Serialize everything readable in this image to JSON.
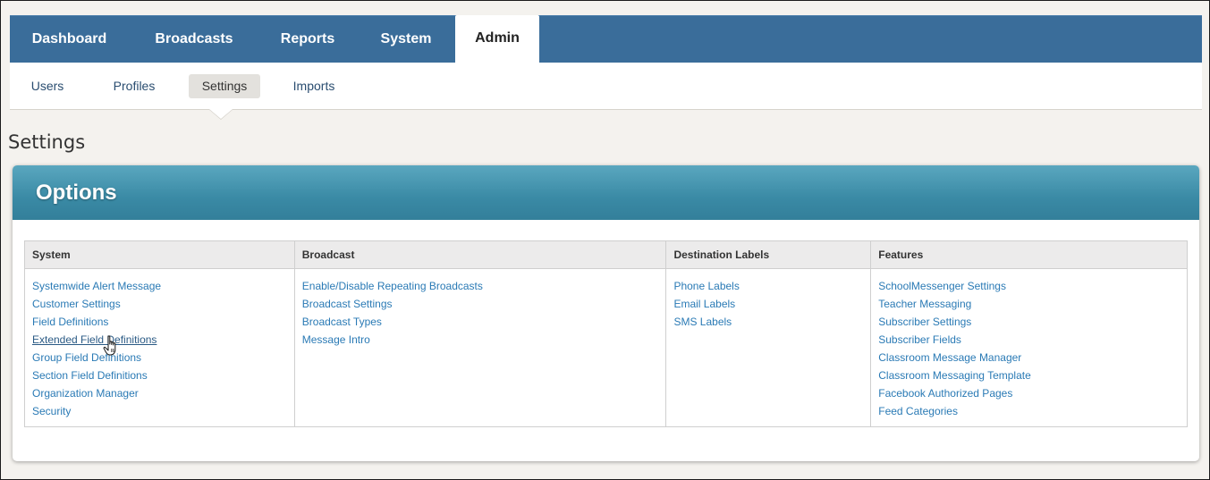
{
  "top_tabs": [
    {
      "label": "Dashboard",
      "active": false
    },
    {
      "label": "Broadcasts",
      "active": false
    },
    {
      "label": "Reports",
      "active": false
    },
    {
      "label": "System",
      "active": false
    },
    {
      "label": "Admin",
      "active": true
    }
  ],
  "sub_tabs": [
    {
      "label": "Users",
      "active": false
    },
    {
      "label": "Profiles",
      "active": false
    },
    {
      "label": "Settings",
      "active": true
    },
    {
      "label": "Imports",
      "active": false
    }
  ],
  "page_title": "Settings",
  "panel": {
    "title": "Options",
    "columns": [
      {
        "header": "System",
        "links": [
          "Systemwide Alert Message",
          "Customer Settings",
          "Field Definitions",
          "Extended Field Definitions",
          "Group Field Definitions",
          "Section Field Definitions",
          "Organization Manager",
          "Security"
        ]
      },
      {
        "header": "Broadcast",
        "links": [
          "Enable/Disable Repeating Broadcasts",
          "Broadcast Settings",
          "Broadcast Types",
          "Message Intro"
        ]
      },
      {
        "header": "Destination Labels",
        "links": [
          "Phone Labels",
          "Email Labels",
          "SMS Labels"
        ]
      },
      {
        "header": "Features",
        "links": [
          "SchoolMessenger Settings",
          "Teacher Messaging",
          "Subscriber Settings",
          "Subscriber Fields",
          "Classroom Message Manager",
          "Classroom Messaging Template",
          "Facebook Authorized Pages",
          "Feed Categories"
        ]
      }
    ]
  },
  "colors": {
    "topbar": "#3a6d9a",
    "panel_header": "#3a8aa5",
    "link": "#2a7ab5"
  },
  "icons": {
    "cursor": "hand-pointer-icon"
  }
}
